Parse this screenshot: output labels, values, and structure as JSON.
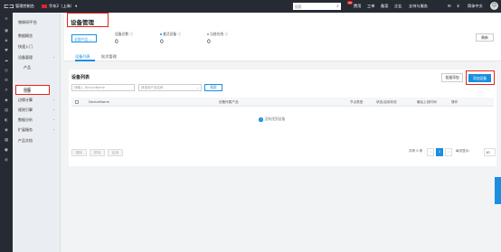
{
  "topbar": {
    "logo_glyph": "⊏⊐",
    "console_label": "管理控制台",
    "region_label": "华东2（上海）",
    "region_caret": "▾",
    "search_placeholder": "搜索",
    "search_glyph": "⌕",
    "badge": "99",
    "nav": [
      "费用",
      "工单",
      "备案",
      "企业",
      "支持与服务"
    ],
    "lang": "简体中文",
    "msg_glyph": "✉",
    "cart_glyph": "⊻",
    "avatar_glyph": "☺"
  },
  "tooltip": {
    "text": "云命令行（Cloud Shell）",
    "close": "×"
  },
  "rail_icons": [
    "≡",
    "▣",
    "◈",
    "♥",
    "☁",
    "◎",
    "⚙",
    "✕",
    "◆",
    "▤",
    "◐",
    "◉",
    "▦",
    "●",
    "◍"
  ],
  "sidebar": {
    "title": "物联网平台",
    "items": [
      {
        "label": "数据概览",
        "caret": ""
      },
      {
        "label": "快速入门",
        "caret": ""
      },
      {
        "label": "设备管理",
        "caret": "⌄"
      },
      {
        "label": "产品",
        "caret": ""
      },
      {
        "label": "设备",
        "caret": ""
      },
      {
        "label": "分组",
        "caret": ""
      },
      {
        "label": "边缘计算",
        "caret": "⌄"
      },
      {
        "label": "规则引擎",
        "caret": "⌄"
      },
      {
        "label": "数据分析",
        "caret": "⌄"
      },
      {
        "label": "扩展服务",
        "caret": "⌄"
      },
      {
        "label": "产品文档",
        "caret": ""
      }
    ]
  },
  "header": {
    "title": "设备管理",
    "product_select": "全部产品",
    "product_caret": "⌄",
    "stats": [
      {
        "label": "设备总数",
        "value": "0",
        "dot": ""
      },
      {
        "label": "激活设备",
        "value": "0",
        "dot": "#1a8fe0"
      },
      {
        "label": "当前在线",
        "value": "0",
        "dot": "#52c41a"
      }
    ],
    "refresh": "刷新"
  },
  "tabs": [
    "设备列表",
    "批次管理"
  ],
  "panel": {
    "title": "设备列表",
    "batch_add": "批量添加",
    "add_device": "添加设备",
    "filter_name_placeholder": "请输入 DeviceName",
    "filter_product_placeholder": "请选择产品名称",
    "filter_caret": "⌄",
    "search_button": "搜索",
    "columns": [
      "DeviceName",
      "设备所属产品",
      "节点类型",
      "状态/启用状态",
      "最后上线时间",
      "操作"
    ],
    "empty_icon": "i",
    "empty_text": "没有找到设备",
    "bulk_actions": [
      "删除",
      "禁用",
      "启用"
    ],
    "pagination": {
      "total": "共有 0 条",
      "prev": "‹",
      "current": "1",
      "next": "›",
      "per_page_label": "每页显示:",
      "per_page": "10"
    }
  },
  "accent_color": "#1a8fe0",
  "highlight_color": "#e2231a"
}
